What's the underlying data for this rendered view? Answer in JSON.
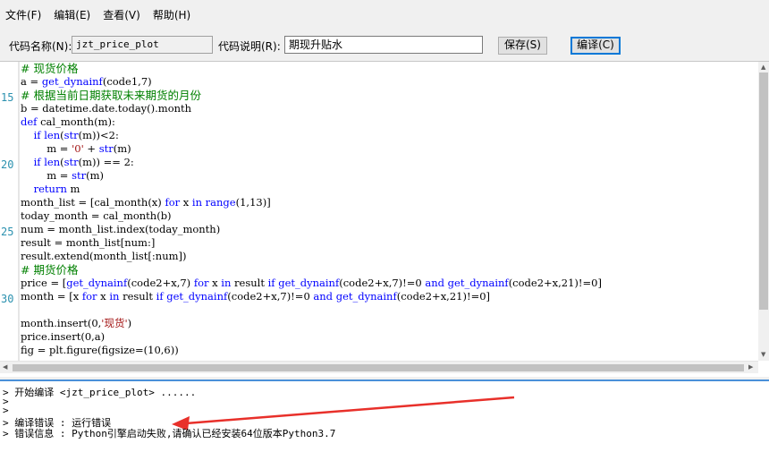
{
  "menu": [
    "文件(F)",
    "编辑(E)",
    "查看(V)",
    "帮助(H)"
  ],
  "toolbar": {
    "code_name_label": "代码名称(N):",
    "code_name_value": "jzt_price_plot",
    "code_desc_label": "代码说明(R):",
    "code_desc_value": "期现升贴水",
    "save_label": "保存(S)",
    "compile_label": "编译(C)"
  },
  "line_numbers": [
    {
      "n": "15",
      "row": 2
    },
    {
      "n": "20",
      "row": 7
    },
    {
      "n": "25",
      "row": 12
    },
    {
      "n": "30",
      "row": 17
    }
  ],
  "code_lines": [
    "# 现货价格",
    "a = get_dynainf(code1,7)",
    "# 根据当前日期获取未来期货的月份",
    "b = datetime.date.today().month",
    "def cal_month(m):",
    "    if len(str(m))<2:",
    "        m = '0' + str(m)",
    "    if len(str(m)) == 2:",
    "        m = str(m)",
    "    return m",
    "month_list = [cal_month(x) for x in range(1,13)]",
    "today_month = cal_month(b)",
    "num = month_list.index(today_month)",
    "result = month_list[num:]",
    "result.extend(month_list[:num])",
    "# 期货价格",
    "price = [get_dynainf(code2+x,7) for x in result if get_dynainf(code2+x,7)!=0 and get_dynainf(code2+x,21)!=0]",
    "month = [x for x in result if get_dynainf(code2+x,7)!=0 and get_dynainf(code2+x,21)!=0]",
    "",
    "month.insert(0,'现货')",
    "price.insert(0,a)",
    "fig = plt.figure(figsize=(10,6))"
  ],
  "output_lines": [
    "> 开始编译 <jzt_price_plot> ......",
    ">",
    ">",
    "> 编译错误 : 运行错误",
    "> 错误信息 : Python引擎启动失败,请确认已经安装64位版本Python3.7"
  ],
  "colors": {
    "keyword": "#0000ff",
    "comment": "#008000",
    "string": "#a31515",
    "line_number": "#2b91af",
    "annotation_arrow": "#e8302a",
    "output_border": "#4a90d9"
  }
}
